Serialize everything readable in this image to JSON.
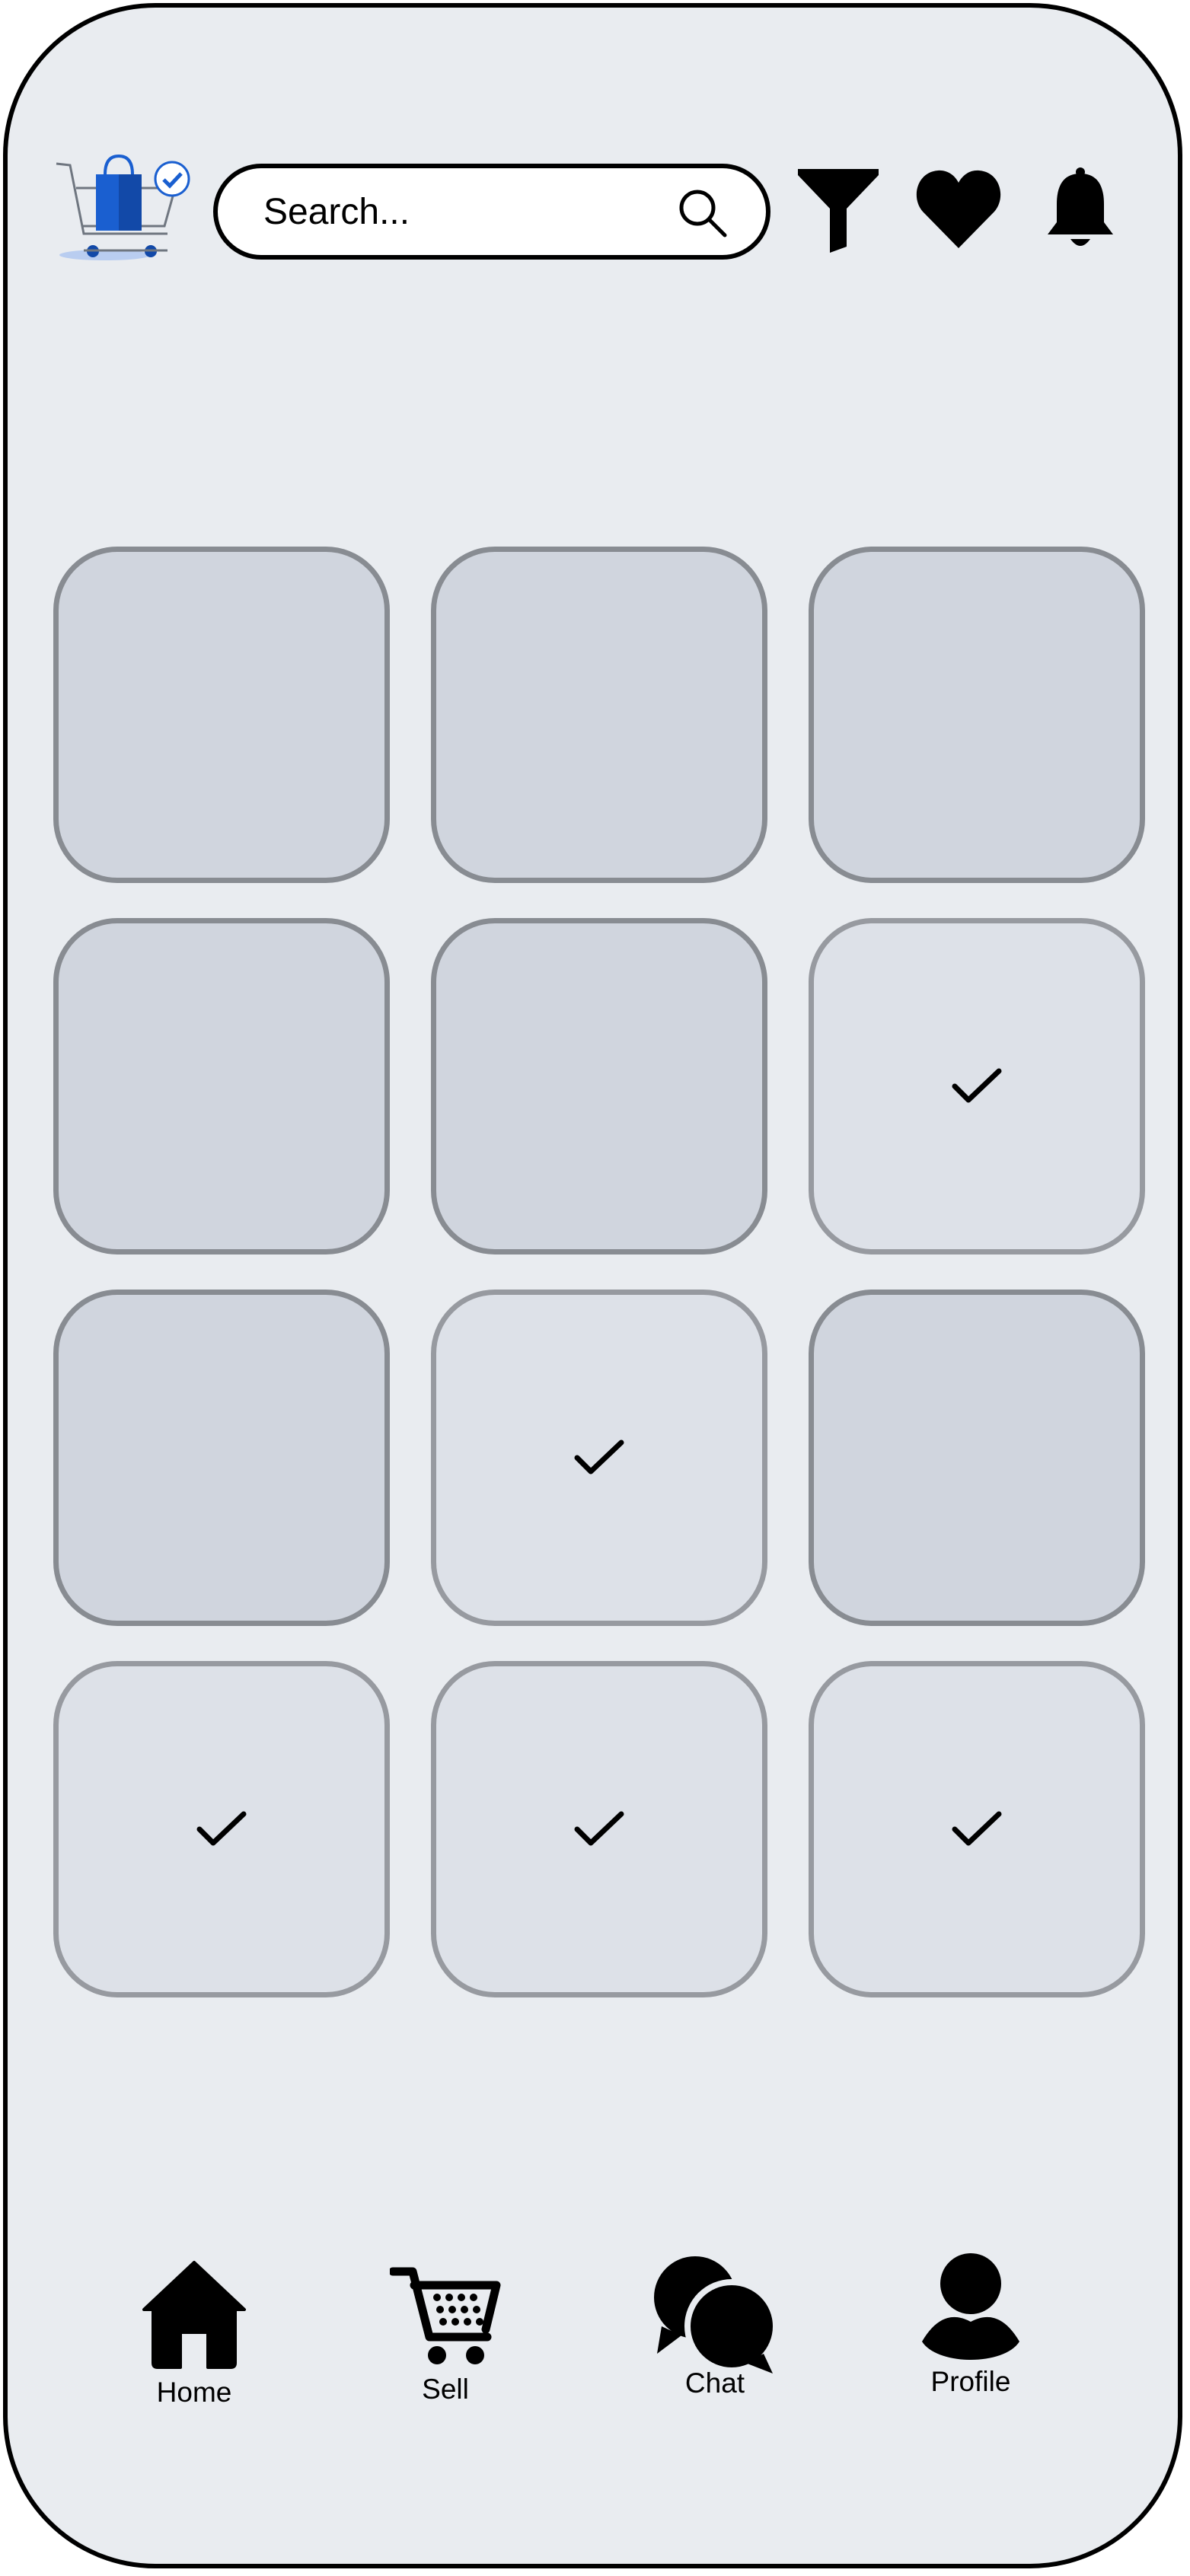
{
  "header": {
    "logo_icon": "shopping-cart-logo-icon",
    "search": {
      "placeholder": "Search...",
      "icon": "search-icon"
    },
    "actions": [
      {
        "icon": "filter-icon"
      },
      {
        "icon": "heart-icon"
      },
      {
        "icon": "bell-icon"
      }
    ]
  },
  "grid": {
    "columns": 3,
    "tiles": [
      {
        "selected": false
      },
      {
        "selected": false
      },
      {
        "selected": false
      },
      {
        "selected": false
      },
      {
        "selected": false
      },
      {
        "selected": true
      },
      {
        "selected": false
      },
      {
        "selected": true
      },
      {
        "selected": false
      },
      {
        "selected": true
      },
      {
        "selected": true
      },
      {
        "selected": true
      }
    ]
  },
  "nav": {
    "home": {
      "label": "Home",
      "icon": "home-icon"
    },
    "sell": {
      "label": "Sell",
      "icon": "cart-icon"
    },
    "chat": {
      "label": "Chat",
      "icon": "chat-icon"
    },
    "profile": {
      "label": "Profile",
      "icon": "user-icon"
    }
  },
  "colors": {
    "background": "#e9ecf0",
    "tile_default": "#d0d5de",
    "tile_selected": "#dde1e8",
    "tile_border": "#888c92",
    "logo_blue": "#1a5fd0"
  }
}
